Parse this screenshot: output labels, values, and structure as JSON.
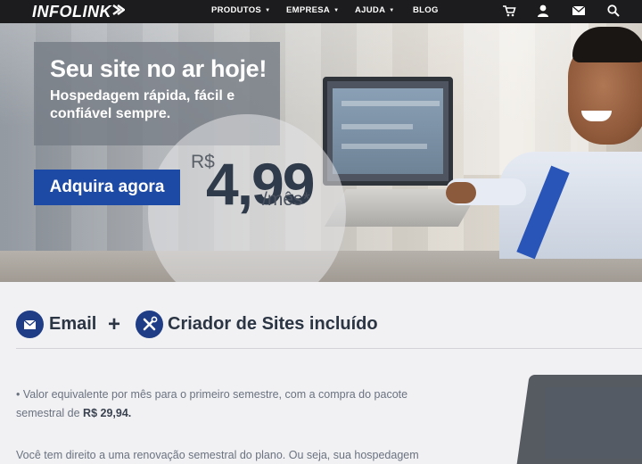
{
  "nav": {
    "logo": "INFOLINK",
    "menu": [
      {
        "label": "PRODUTOS",
        "has_caret": true
      },
      {
        "label": "EMPRESA",
        "has_caret": true
      },
      {
        "label": "AJUDA",
        "has_caret": true
      },
      {
        "label": "BLOG",
        "has_caret": false
      }
    ],
    "icons": [
      "cart-icon",
      "user-icon",
      "mail-icon",
      "search-icon"
    ],
    "caret": "▼"
  },
  "hero": {
    "title": "Seu site no ar hoje!",
    "subtitle": "Hospedagem rápida, fácil e confiável sempre.",
    "cta_label": "Adquira agora",
    "price": {
      "currency": "R$",
      "value": "4,99",
      "period": "/mês*"
    }
  },
  "features": {
    "email_label": "Email",
    "plus": "+",
    "builder_label": "Criador de Sites incluído"
  },
  "notes": {
    "bullet_text": "• Valor equivalente por mês para o primeiro semestre, com a compra do pacote semestral de",
    "bullet_price": "R$ 29,94.",
    "renewal_text": "Você tem direito a uma renovação semestral do plano. Ou seja, sua hospedagem"
  },
  "colors": {
    "nav_bg": "#1c1c1e",
    "cta_bg": "#1d4aa5",
    "icon_bg": "#1e3d86",
    "heading_text": "#2b3544"
  }
}
